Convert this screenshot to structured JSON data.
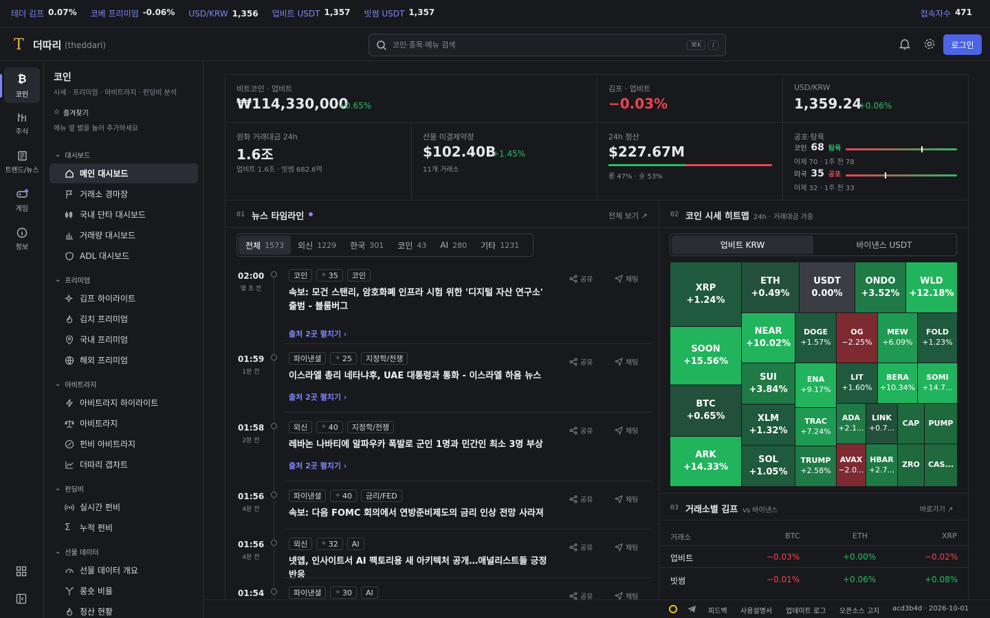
{
  "ticker": {
    "items": [
      {
        "label": "테더 김프",
        "value": "0.07%"
      },
      {
        "label": "코베 프리미엄",
        "value": "-0.06%"
      },
      {
        "label": "USD/KRW",
        "value": "1,356"
      },
      {
        "label": "업비트 USDT",
        "value": "1,357"
      },
      {
        "label": "빗썸 USDT",
        "value": "1,357"
      }
    ],
    "visitors_label": "접속자수",
    "visitors_value": "471"
  },
  "header": {
    "logo_letter": "T",
    "name": "더따리",
    "sub": "(theddari)",
    "search_placeholder": "코인·종목·메뉴 검색",
    "kbd1": "⌘K",
    "kbd2": "/",
    "login": "로그인"
  },
  "rail": [
    {
      "label": "코인",
      "icon": "bitcoin-icon"
    },
    {
      "label": "주식",
      "icon": "stock-icon"
    },
    {
      "label": "트렌드/뉴스",
      "icon": "news-icon"
    },
    {
      "label": "게임",
      "icon": "gamepad-icon"
    },
    {
      "label": "정보",
      "icon": "info-icon"
    }
  ],
  "sidebar": {
    "title": "코인",
    "subtitle": "시세 · 프리미엄 · 아비트라지 · 펀딩비 분석",
    "fav_label": "즐겨찾기",
    "fav_hint": "메뉴 옆 별을 눌러 추가하세요",
    "sections": [
      {
        "title": "대시보드",
        "items": [
          "메인 대시보드",
          "거래소 경마장",
          "국내 단타 대시보드",
          "거래량 대시보드",
          "ADL 대시보드"
        ]
      },
      {
        "title": "프리미엄",
        "items": [
          "김프 하이라이트",
          "김치 프리미엄",
          "국내 프리미엄",
          "해외 프리미엄"
        ]
      },
      {
        "title": "아비트라지",
        "items": [
          "아비트라지 하이라이트",
          "아비트라지",
          "펀비 아비트라지",
          "더따리 갭차트"
        ]
      },
      {
        "title": "펀딩비",
        "items": [
          "실시간 펀비",
          "누적 펀비"
        ]
      },
      {
        "title": "선물 데이터",
        "items": [
          "선물 데이터 개요",
          "롱숏 비율",
          "청산 현황"
        ]
      }
    ]
  },
  "stats": {
    "btc": {
      "label": "비트코인 · 업비트",
      "value": "₩114,330,000",
      "change": "+0.65%"
    },
    "kimp": {
      "label": "김프 · 업비트",
      "value": "−0.03%"
    },
    "usdkrw": {
      "label": "USD/KRW",
      "value": "1,359.24",
      "change": "+0.06%"
    },
    "krwvol": {
      "label": "원화 거래대금 24h",
      "value": "1.6조",
      "sub": "업비트 1.6조 · 빗썸 682.6억"
    },
    "oi": {
      "label": "선물 미결제약정",
      "value": "$102.40B",
      "change": "+1.45%",
      "sub": "11개 거래소"
    },
    "liq": {
      "label": "24h 청산",
      "value": "$227.67M",
      "sub": "롱 47% · 숏 53%",
      "long_ratio": 0.47
    },
    "fg": {
      "label": "공포·탐욕",
      "coin": {
        "label": "코인",
        "value": "68",
        "state": "탐욕",
        "sub": "어제 70 · 1주 전 78",
        "level": 0.68
      },
      "us": {
        "label": "미국",
        "value": "35",
        "state": "공포",
        "sub": "어제 32 · 1주 전 33",
        "level": 0.35
      }
    }
  },
  "news": {
    "num": "01",
    "title": "뉴스 타임라인",
    "view_all": "전체 보기 ↗",
    "filters": [
      {
        "label": "전체",
        "count": "1573"
      },
      {
        "label": "외신",
        "count": "1229"
      },
      {
        "label": "한국",
        "count": "301"
      },
      {
        "label": "코인",
        "count": "43"
      },
      {
        "label": "AI",
        "count": "280"
      },
      {
        "label": "기타",
        "count": "1231"
      }
    ],
    "share": "공유",
    "chat": "채팅",
    "expand": "출처 2곳 펼치기",
    "items": [
      {
        "time": "02:00",
        "ago": "몇 초 전",
        "tags": [
          "코인",
          "35",
          "코인"
        ],
        "title": "속보: 모건 스탠리, 암호화폐 인프라 시험 위한 '디지털 자산 연구소' 출범 - 블룸버그",
        "expand": true
      },
      {
        "time": "01:59",
        "ago": "1분 전",
        "tags": [
          "파이낸셜",
          "25",
          "지정학/전쟁"
        ],
        "title": "이스라엘 총리 네타냐후, UAE 대통령과 통화 - 이스라엘 하욤 뉴스",
        "expand": true
      },
      {
        "time": "01:58",
        "ago": "2분 전",
        "tags": [
          "외신",
          "40",
          "지정학/전쟁"
        ],
        "title": "레바논 나바티에 알파우카 폭발로 군인 1명과 민간인 최소 3명 부상",
        "expand": true
      },
      {
        "time": "01:56",
        "ago": "4분 전",
        "tags": [
          "파이낸셜",
          "40",
          "금리/FED"
        ],
        "title": "속보: 다음 FOMC 회의에서 연방준비제도의 금리 인상 전망 사라져",
        "expand": false
      },
      {
        "time": "01:56",
        "ago": "4분 전",
        "tags": [
          "외신",
          "32",
          "AI"
        ],
        "title": "넷엡, 인사이트서 AI 팩토리용 새 아키텍처 공개…애널리스트들 긍정 반응",
        "expand": false
      },
      {
        "time": "01:54",
        "ago": "",
        "tags": [
          "파이낸셜",
          "30",
          "AI"
        ],
        "title": "",
        "expand": false
      }
    ]
  },
  "heatmap": {
    "num": "02",
    "title": "코인 시세 히트맵",
    "sub": "24h · 거래대금 가중",
    "tabs": [
      "업비트 KRW",
      "바이낸스 USDT"
    ],
    "cells": [
      {
        "s": "XRP",
        "c": "+1.24%"
      },
      {
        "s": "ETH",
        "c": "+0.49%"
      },
      {
        "s": "USDT",
        "c": "0.00%"
      },
      {
        "s": "ONDO",
        "c": "+3.52%"
      },
      {
        "s": "WLD",
        "c": "+12.18%"
      },
      {
        "s": "SOON",
        "c": "+15.56%"
      },
      {
        "s": "NEAR",
        "c": "+10.02%"
      },
      {
        "s": "DOGE",
        "c": "+1.57%"
      },
      {
        "s": "OG",
        "c": "−2.25%"
      },
      {
        "s": "MEW",
        "c": "+6.09%"
      },
      {
        "s": "FOLD",
        "c": "+1.23%"
      },
      {
        "s": "SUI",
        "c": "+3.84%"
      },
      {
        "s": "ENA",
        "c": "+9.17%"
      },
      {
        "s": "LIT",
        "c": "+1.60%"
      },
      {
        "s": "BERA",
        "c": "+10.34%"
      },
      {
        "s": "SOMI",
        "c": "+14.7..."
      },
      {
        "s": "BTC",
        "c": "+0.65%"
      },
      {
        "s": "XLM",
        "c": "+1.32%"
      },
      {
        "s": "TRAC",
        "c": "+7.24%"
      },
      {
        "s": "ADA",
        "c": "+2.1..."
      },
      {
        "s": "LINK",
        "c": "+0.7..."
      },
      {
        "s": "CAP",
        "c": ""
      },
      {
        "s": "PUMP",
        "c": ""
      },
      {
        "s": "ARK",
        "c": "+14.33%"
      },
      {
        "s": "SOL",
        "c": "+1.05%"
      },
      {
        "s": "TRUMP",
        "c": "+2.58%"
      },
      {
        "s": "AVAX",
        "c": "−2.0..."
      },
      {
        "s": "HBAR",
        "c": "+2.7..."
      },
      {
        "s": "ZRO",
        "c": ""
      },
      {
        "s": "CAS...",
        "c": ""
      }
    ]
  },
  "kimp": {
    "num": "03",
    "title": "거래소별 김프",
    "sub": "vs 바이낸스",
    "link": "바로가기 ↗",
    "cols": [
      "거래소",
      "BTC",
      "ETH",
      "XRP"
    ],
    "rows": [
      [
        "업비트",
        "−0.03%",
        "+0.00%",
        "−0.02%"
      ],
      [
        "빗썸",
        "−0.01%",
        "+0.06%",
        "+0.08%"
      ]
    ]
  },
  "footer": {
    "links": [
      "피드백",
      "사용설명서",
      "업데이트 로그",
      "오픈소스 고지"
    ],
    "build": "acd3b4d · 2026-10-01"
  },
  "colors": {
    "accent": "#7d86f5",
    "up": "#2ebd63",
    "down": "#f0444e",
    "brand": "#4d63e6"
  }
}
